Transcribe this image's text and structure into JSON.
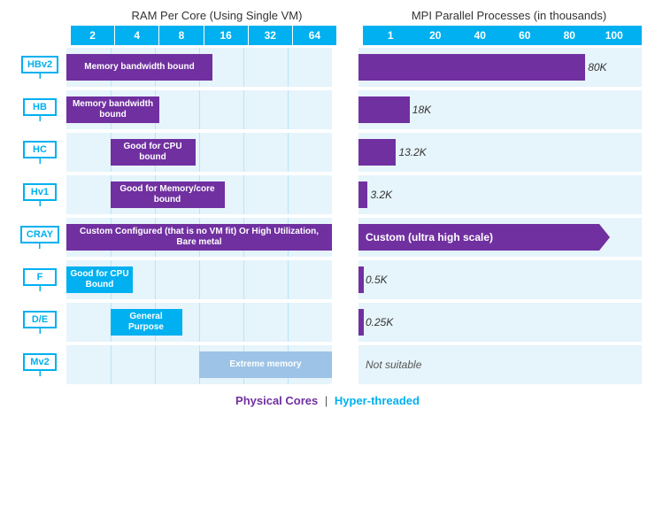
{
  "titles": {
    "ram": "RAM Per Core (Using Single VM)",
    "mpi": "MPI Parallel Processes (in thousands)"
  },
  "ram_scale": [
    "2",
    "4",
    "8",
    "16",
    "32",
    "64"
  ],
  "mpi_scale": [
    "1",
    "20",
    "40",
    "60",
    "80",
    "100"
  ],
  "rows": [
    {
      "vm": "HBv2",
      "ram_bar": {
        "label": "Memory bandwidth bound",
        "color": "purple",
        "left_pct": 0,
        "width_pct": 55
      },
      "mpi": {
        "type": "bar",
        "width_pct": 80,
        "color": "purple",
        "value": "80K"
      }
    },
    {
      "vm": "HB",
      "ram_bar": {
        "label": "Memory\nbandwidth bound",
        "color": "purple",
        "left_pct": 0,
        "width_pct": 35
      },
      "mpi": {
        "type": "bar",
        "width_pct": 18,
        "color": "purple",
        "value": "18K"
      }
    },
    {
      "vm": "HC",
      "ram_bar": {
        "label": "Good for\nCPU bound",
        "color": "purple",
        "left_pct": 16.5,
        "width_pct": 32
      },
      "mpi": {
        "type": "bar",
        "width_pct": 13.2,
        "color": "purple",
        "value": "13.2K"
      }
    },
    {
      "vm": "Hv1",
      "ram_bar": {
        "label": "Good for\nMemory/core\nbound",
        "color": "purple",
        "left_pct": 16.5,
        "width_pct": 43
      },
      "mpi": {
        "type": "bar",
        "width_pct": 3.2,
        "color": "purple",
        "value": "3.2K"
      }
    },
    {
      "vm": "CRAY",
      "ram_bar": {
        "label": "Custom Configured  (that is no VM fit)\nOr High Utilization, Bare metal",
        "color": "purple",
        "left_pct": 0,
        "width_pct": 100
      },
      "mpi": {
        "type": "arrow",
        "width_pct": 85,
        "color": "purple",
        "value": "Custom (ultra high scale)"
      }
    },
    {
      "vm": "F",
      "ram_bar": {
        "label": "Good for\nCPU Bound",
        "color": "blue",
        "left_pct": 0,
        "width_pct": 25
      },
      "mpi": {
        "type": "bar_small",
        "width_pct": 0.5,
        "color": "purple",
        "value": "0.5K"
      }
    },
    {
      "vm": "D/E",
      "ram_bar": {
        "label": "General\nPurpose",
        "color": "blue",
        "left_pct": 16.5,
        "width_pct": 27
      },
      "mpi": {
        "type": "bar_small",
        "width_pct": 0.25,
        "color": "purple",
        "value": "0.25K"
      }
    },
    {
      "vm": "Mv2",
      "ram_bar": {
        "label": "Extreme\nmemory",
        "color": "light-blue",
        "left_pct": 50,
        "width_pct": 50
      },
      "mpi": {
        "type": "text",
        "value": "Not suitable"
      }
    }
  ],
  "footer": {
    "physical": "Physical Cores",
    "separator": "|",
    "hyper": "Hyper-threaded"
  }
}
